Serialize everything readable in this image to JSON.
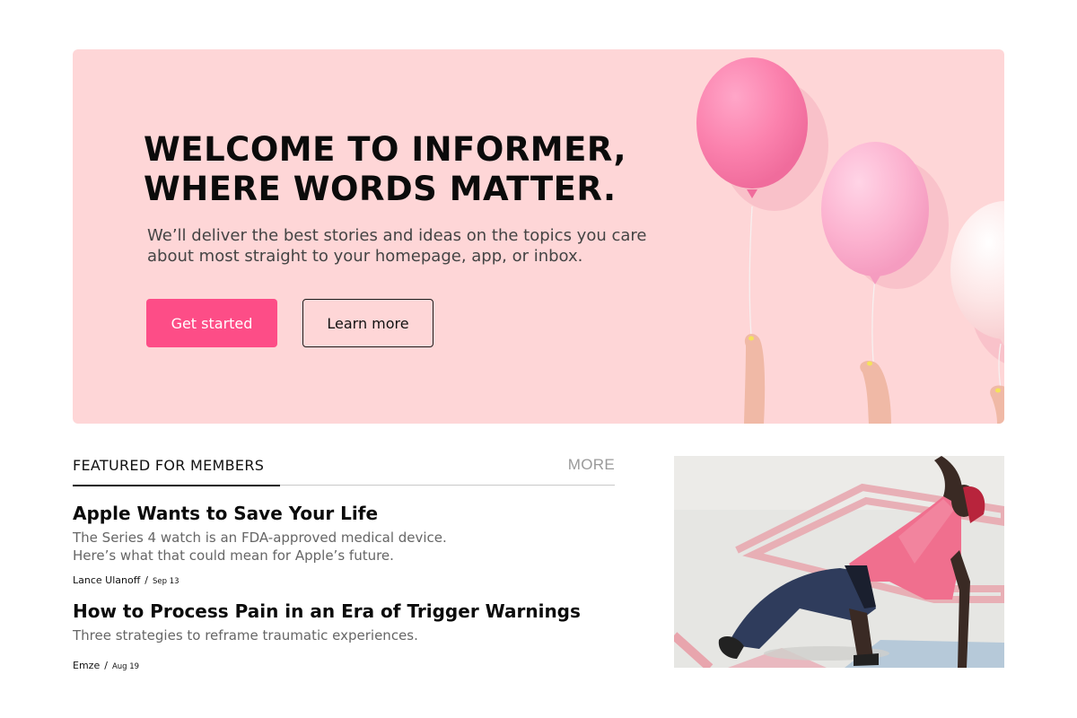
{
  "hero": {
    "title_line1": "WELCOME TO INFORMER,",
    "title_line2": "WHERE WORDS MATTER.",
    "subtitle": "We’ll deliver the best stories and ideas on the topics you care about most straight to your homepage, app, or inbox.",
    "primary_button": "Get started",
    "secondary_button": "Learn more",
    "background_color": "#fed6d7",
    "accent_color": "#fd4d87"
  },
  "featured": {
    "heading": "FEATURED FOR MEMBERS",
    "more_label": "MORE",
    "articles": [
      {
        "title": "Apple Wants to Save Your Life",
        "description_line1": "The Series 4 watch is an FDA-approved medical device.",
        "description_line2": "Here’s what that could mean for Apple’s future.",
        "author": "Lance Ulanoff",
        "separator": "/",
        "date": "Sep 13"
      },
      {
        "title": "How to Process Pain in an Era of Trigger Warnings",
        "description_line1": "Three strategies to reframe traumatic experiences.",
        "author": "Emze",
        "separator": "/",
        "date": "Aug 19"
      }
    ]
  }
}
